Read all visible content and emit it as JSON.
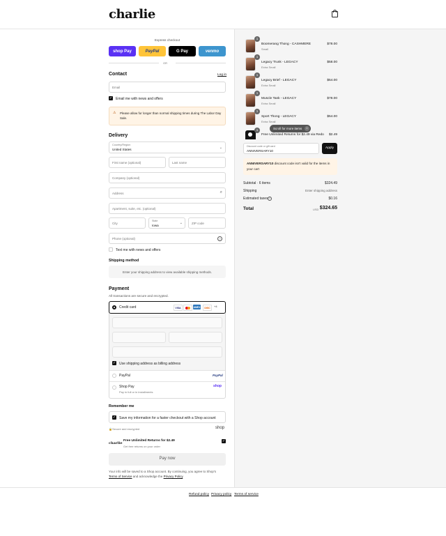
{
  "header": {
    "logo": "charlie",
    "cart_icon": "shopping-bag-icon"
  },
  "express": {
    "title": "Express checkout",
    "buttons": [
      {
        "label": "shop Pay",
        "color": "#5a31f4"
      },
      {
        "label": "PayPal",
        "color": "#ffc439"
      },
      {
        "label": "G Pay",
        "color": "#000000"
      },
      {
        "label": "venmo",
        "color": "#3d95ce"
      }
    ],
    "or": "OR"
  },
  "contact": {
    "title": "Contact",
    "login": "Log in",
    "email_placeholder": "Email",
    "news_label": "Email me with news and offers",
    "notice": "Please allow for longer than normal shipping times during The Labor Day Sale."
  },
  "delivery": {
    "title": "Delivery",
    "country_label": "Country/Region",
    "country_value": "United States",
    "first_name": "First name (optional)",
    "last_name": "Last name",
    "company": "Company (optional)",
    "address": "Address",
    "apartment": "Apartment, suite, etc. (optional)",
    "city": "City",
    "state_label": "State",
    "state_value": "Iowa",
    "zip": "ZIP code",
    "phone": "Phone (optional)",
    "text_label": "Text me with news and offers"
  },
  "shipping": {
    "title": "Shipping method",
    "message": "Enter your shipping address to view available shipping methods."
  },
  "payment": {
    "title": "Payment",
    "subtitle": "All transactions are secure and encrypted.",
    "credit_card": "Credit card",
    "card_brands": [
      "VISA",
      "MC",
      "AMEX",
      "DISC",
      "+4"
    ],
    "billing_label": "Use shipping address as billing address",
    "paypal": "PayPal",
    "paypal_logo": "PayPal",
    "shop_pay": "Shop Pay",
    "shop_pay_sub": "Pay in full or in installments",
    "shop_logo": "shop"
  },
  "remember": {
    "title": "Remember me",
    "save_label": "Save my information for a faster checkout with a Shop account",
    "secure": "Secure and encrypted",
    "shop_logo": "shop"
  },
  "returns": {
    "logo": "charlie",
    "title": "Free Unlimited Returns for $2.49",
    "subtitle": "Get free returns on your order"
  },
  "pay_now": "Pay now",
  "legal": {
    "text1": "Your info will be saved to a Shop account. By continuing, you agree to Shop's",
    "terms": "Terms of Service",
    "text2": "and acknowledge the",
    "privacy": "Privacy Policy",
    "end": "."
  },
  "order": {
    "items": [
      {
        "qty": "1",
        "title": "Boomerang Thong - CASHMERE",
        "variant": "Small",
        "price": "$78.00"
      },
      {
        "qty": "1",
        "title": "Legacy Trunk - LEGACY",
        "variant": "Extra Small",
        "price": "$58.00"
      },
      {
        "qty": "1",
        "title": "Legacy Brief - LEGACY",
        "variant": "Extra Small",
        "price": "$54.00"
      },
      {
        "qty": "1",
        "title": "Muscle Tank - LEGACY",
        "variant": "Extra Small",
        "price": "$78.00"
      },
      {
        "qty": "1",
        "title": "Sport Thong - LEGACY",
        "variant": "Extra Small",
        "price": "$54.00"
      }
    ],
    "returns_item": {
      "qty": "1",
      "title": "Free Unlimited Returns for $2.49 via Redo",
      "price": "$2.49"
    },
    "scroll_hint": "Scroll for more items",
    "discount_label": "Discount code or gift card",
    "discount_value": "ANNIVERSARY10",
    "apply": "Apply",
    "discount_error_code": "ANNIVERSARY10",
    "discount_error": "discount code isn't valid for the items in your cart",
    "subtotal_label": "Subtotal · 6 items",
    "subtotal": "$324.49",
    "shipping_label": "Shipping",
    "shipping_value": "Enter shipping address",
    "taxes_label": "Estimated taxes",
    "taxes": "$0.16",
    "total_label": "Total",
    "currency": "USD",
    "total": "$324.65"
  },
  "footer": {
    "refund": "Refund policy",
    "privacy": "Privacy policy",
    "terms": "Terms of service"
  }
}
